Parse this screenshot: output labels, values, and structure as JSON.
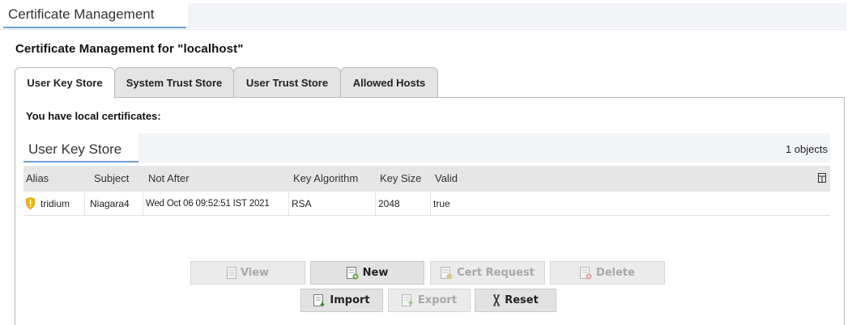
{
  "header": {
    "tab_label": "Certificate Management"
  },
  "page_title": "Certificate Management for \"localhost\"",
  "store_tabs": [
    {
      "label": "User Key Store",
      "active": true
    },
    {
      "label": "System Trust Store",
      "active": false
    },
    {
      "label": "User Trust Store",
      "active": false
    },
    {
      "label": "Allowed Hosts",
      "active": false
    }
  ],
  "panel": {
    "message": "You have local certificates:",
    "table_tab": "User Key Store",
    "object_count": "1 objects",
    "columns": [
      "Alias",
      "Subject",
      "Not After",
      "Key Algorithm",
      "Key Size",
      "Valid"
    ],
    "rows": [
      {
        "alias": "tridium",
        "subject": "Niagara4",
        "not_after": "Wed Oct 06 09:52:51 IST 2021",
        "key_algorithm": "RSA",
        "key_size": "2048",
        "valid": "true",
        "icon": "warning-shield-icon"
      }
    ]
  },
  "buttons": {
    "view": {
      "label": "View",
      "enabled": false
    },
    "new": {
      "label": "New",
      "enabled": true
    },
    "cert_request": {
      "label": "Cert Request",
      "enabled": false
    },
    "delete": {
      "label": "Delete",
      "enabled": false
    },
    "import": {
      "label": "Import",
      "enabled": true
    },
    "export": {
      "label": "Export",
      "enabled": false
    },
    "reset": {
      "label": "Reset",
      "enabled": true
    }
  },
  "colors": {
    "accent": "#6a9fd1",
    "warning": "#f2b705"
  }
}
